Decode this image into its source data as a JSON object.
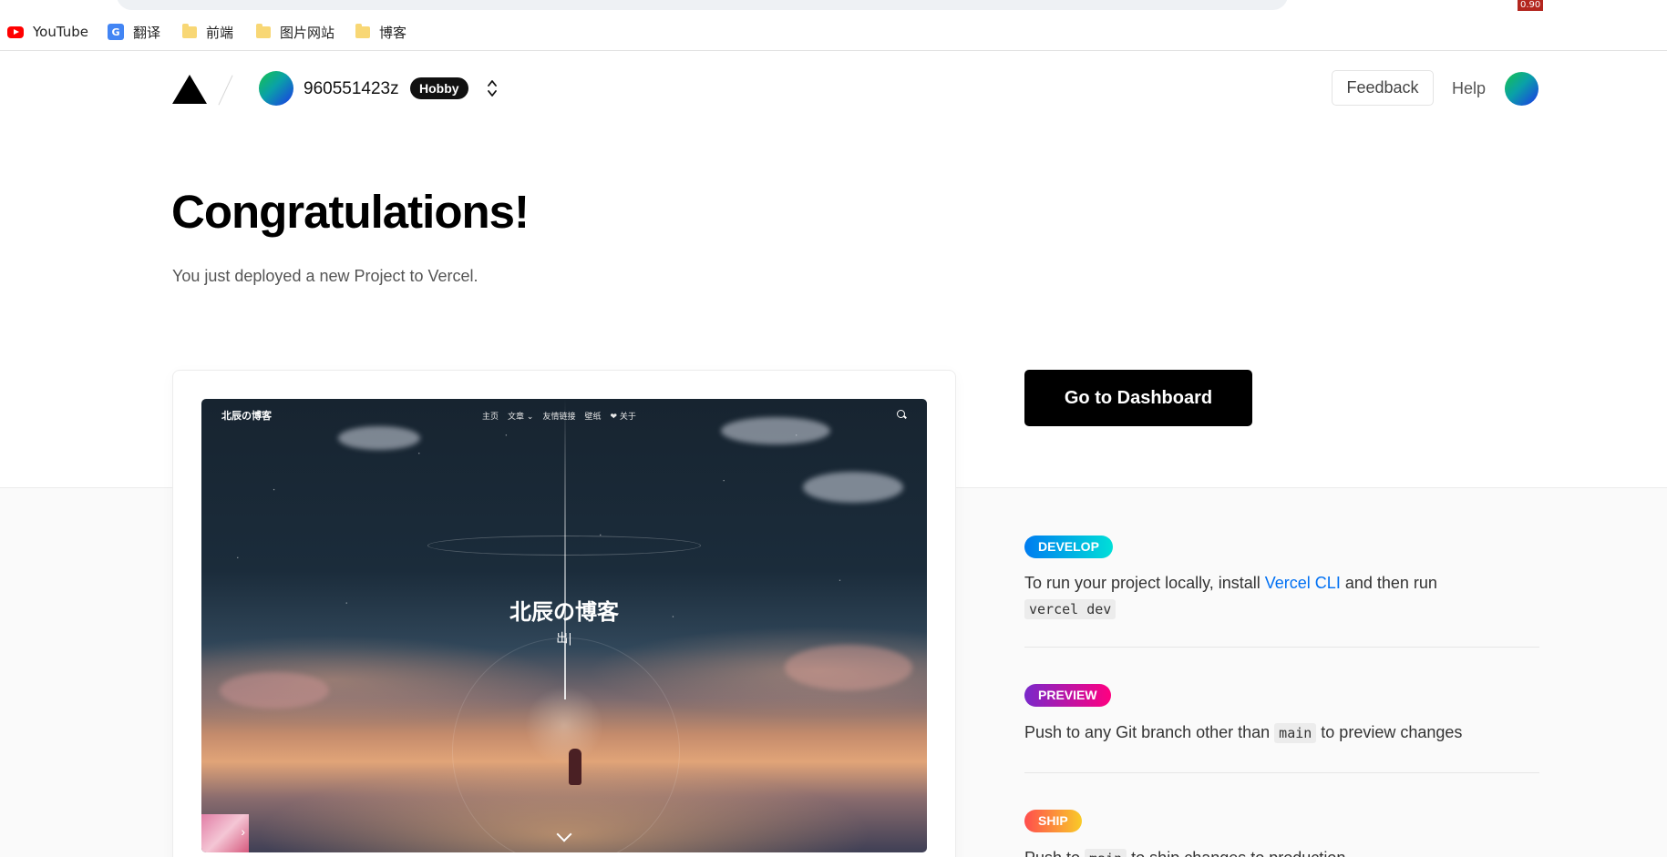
{
  "browser": {
    "extension_badge": "0.90"
  },
  "bookmarks": [
    {
      "label": "YouTube",
      "icon": "youtube-icon"
    },
    {
      "label": "翻译",
      "icon": "translate-icon"
    },
    {
      "label": "前端",
      "icon": "folder-icon"
    },
    {
      "label": "图片网站",
      "icon": "folder-icon"
    },
    {
      "label": "博客",
      "icon": "folder-icon"
    }
  ],
  "header": {
    "account_name": "960551423z",
    "plan_badge": "Hobby",
    "feedback_label": "Feedback",
    "help_label": "Help"
  },
  "hero": {
    "title": "Congratulations!",
    "subtitle": "You just deployed a new Project to Vercel."
  },
  "preview": {
    "site_title": "北辰の博客",
    "menu": [
      "主页",
      "文章",
      "友情链接",
      "壁纸",
      "关于"
    ],
    "center_title": "北辰の博客",
    "center_subtitle": "出|"
  },
  "actions": {
    "dashboard_label": "Go to Dashboard"
  },
  "steps": [
    {
      "badge": "DEVELOP",
      "text_before": "To run your project locally, install ",
      "link": "Vercel CLI",
      "text_after": " and then run",
      "code": "vercel dev"
    },
    {
      "badge": "PREVIEW",
      "text_before": "Push to any Git branch other than ",
      "code": "main",
      "text_after": " to preview changes"
    },
    {
      "badge": "SHIP",
      "text_before": "Push to ",
      "code": "main",
      "text_after": " to ship changes to production"
    }
  ],
  "colors": {
    "link": "#0070f3",
    "develop_gradient": [
      "#007cf0",
      "#00dfd8"
    ],
    "preview_gradient": [
      "#7928ca",
      "#ff0080"
    ],
    "ship_gradient": [
      "#ff4d4d",
      "#f9cb28"
    ]
  }
}
